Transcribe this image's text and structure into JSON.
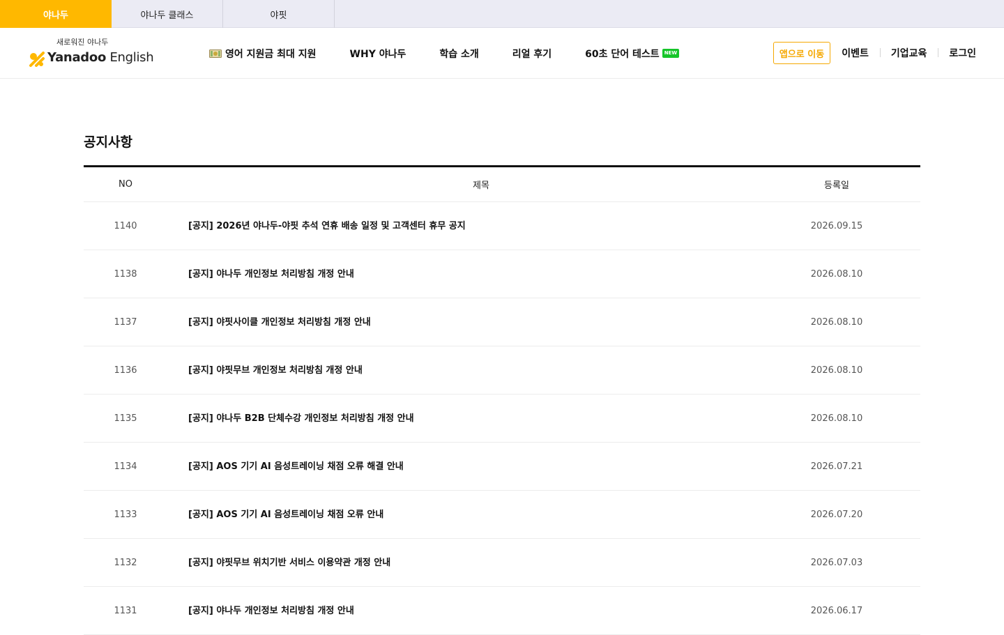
{
  "service_tabs": [
    {
      "label": "야나두",
      "active": true
    },
    {
      "label": "야나두 클래스",
      "active": false
    },
    {
      "label": "야핏",
      "active": false
    }
  ],
  "logo": {
    "tagline": "새로워진 야나두",
    "brand_bold": "Yanadoo",
    "brand_light": "English"
  },
  "gnb": [
    {
      "label": "영어 지원금 최대 지원",
      "icon": "money-icon"
    },
    {
      "label": "WHY 야나두"
    },
    {
      "label": "학습 소개"
    },
    {
      "label": "리얼 후기"
    },
    {
      "label": "60초 단어 테스트",
      "badge": "NEW"
    }
  ],
  "util": {
    "app_button": "앱으로 이동",
    "links": [
      "이벤트",
      "기업교육",
      "로그인"
    ]
  },
  "board": {
    "title": "공지사항",
    "columns": {
      "no": "NO",
      "title": "제목",
      "date": "등록일"
    },
    "rows": [
      {
        "no": "1140",
        "title": "[공지] 2026년 야나두-야핏 추석 연휴 배송 일정 및 고객센터 휴무 공지",
        "date": "2026.09.15"
      },
      {
        "no": "1138",
        "title": "[공지] 야나두 개인정보 처리방침 개정 안내",
        "date": "2026.08.10"
      },
      {
        "no": "1137",
        "title": "[공지] 야핏사이클 개인정보 처리방침 개정 안내",
        "date": "2026.08.10"
      },
      {
        "no": "1136",
        "title": "[공지] 야핏무브 개인정보 처리방침 개정 안내",
        "date": "2026.08.10"
      },
      {
        "no": "1135",
        "title": "[공지] 야나두 B2B 단체수강 개인정보 처리방침 개정 안내",
        "date": "2026.08.10"
      },
      {
        "no": "1134",
        "title": "[공지] AOS 기기 AI 음성트레이닝 채점 오류 해결 안내",
        "date": "2026.07.21"
      },
      {
        "no": "1133",
        "title": "[공지] AOS 기기 AI 음성트레이닝 채점 오류 안내",
        "date": "2026.07.20"
      },
      {
        "no": "1132",
        "title": "[공지] 야핏무브 위치기반 서비스 이용약관 개정 안내",
        "date": "2026.07.03"
      },
      {
        "no": "1131",
        "title": "[공지] 야나두 개인정보 처리방침 개정 안내",
        "date": "2026.06.17"
      }
    ]
  },
  "colors": {
    "brand_yellow": "#ffb800",
    "app_button_orange": "#f5a800",
    "new_badge_green": "#16c52a"
  }
}
